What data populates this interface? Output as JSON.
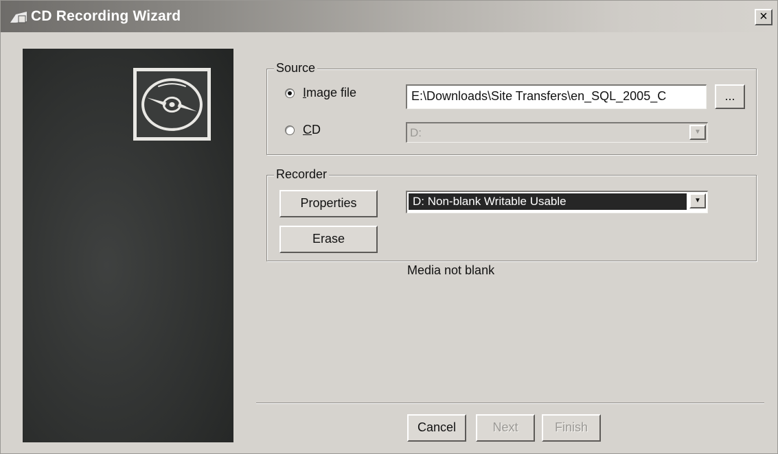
{
  "window": {
    "title": "CD Recording Wizard",
    "close_label": "×"
  },
  "source": {
    "group_label": "Source",
    "image_file_label": "Image file",
    "image_file_selected": true,
    "image_path": "E:\\Downloads\\Site Transfers\\en_SQL_2005_C",
    "browse_label": "...",
    "cd_label": "CD",
    "cd_selected": false,
    "cd_drive": "D:"
  },
  "recorder": {
    "group_label": "Recorder",
    "properties_label": "Properties",
    "erase_label": "Erase",
    "selected_recorder": "D: Non-blank Writable Usable"
  },
  "status_text": "Media not blank",
  "footer": {
    "cancel_label": "Cancel",
    "next_label": "Next",
    "finish_label": "Finish"
  },
  "icons": {
    "title_icon": "cd-wizard-icon",
    "logo": "cd-disc-icon",
    "close": "close-icon",
    "dropdown_arrow": "chevron-down-icon"
  }
}
